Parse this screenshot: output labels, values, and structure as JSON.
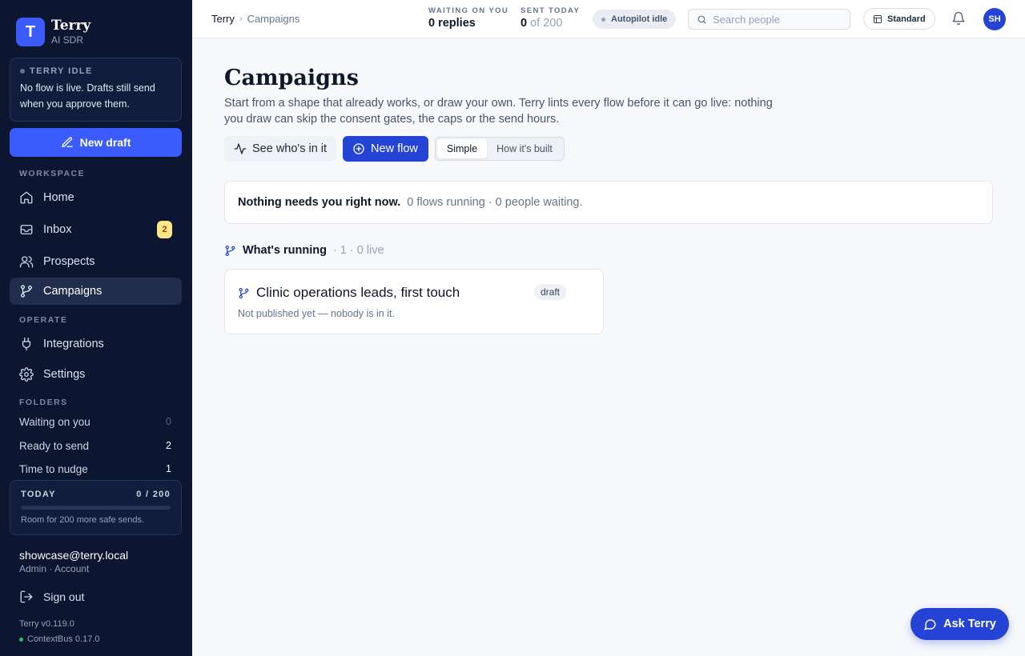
{
  "brand": {
    "logo_letter": "T",
    "name": "Terry",
    "subtitle": "AI SDR"
  },
  "status": {
    "title": "TERRY IDLE",
    "text": "No flow is live. Drafts still send when you approve them."
  },
  "new_draft_label": "New draft",
  "workspace_label": "WORKSPACE",
  "nav": {
    "home": "Home",
    "inbox": "Inbox",
    "inbox_badge": "2",
    "prospects": "Prospects",
    "campaigns": "Campaigns"
  },
  "operate_label": "OPERATE",
  "operate": {
    "integrations": "Integrations",
    "settings": "Settings"
  },
  "folders_label": "FOLDERS",
  "folders": [
    {
      "label": "Waiting on you",
      "count": "0"
    },
    {
      "label": "Ready to send",
      "count": "2"
    },
    {
      "label": "Time to nudge",
      "count": "1"
    }
  ],
  "today": {
    "label": "TODAY",
    "value": "0 / 200",
    "progress_fraction": 0,
    "note": "Room for 200 more safe sends."
  },
  "account": {
    "email": "showcase@terry.local",
    "sub": "Admin · Account"
  },
  "signout_label": "Sign out",
  "version": "Terry v0.119.0",
  "contextbus": "ContextBus 0.17.0",
  "topbar": {
    "crumb_root": "Terry",
    "crumb_current": "Campaigns",
    "waiting_label": "WAITING ON YOU",
    "waiting_value": "0 replies",
    "sent_label": "SENT TODAY",
    "sent_value": "0",
    "sent_of": "of 200",
    "autopilot": "Autopilot idle",
    "search_placeholder": "Search people",
    "mode": "Standard",
    "avatar": "SH"
  },
  "page": {
    "title": "Campaigns",
    "description": "Start from a shape that already works, or draw your own. Terry lints every flow before it can go live: nothing you draw can skip the consent gates, the caps or the send hours.",
    "see_whos_in_it": "See who's in it",
    "new_flow": "New flow",
    "view_simple": "Simple",
    "view_built": "How it's built",
    "notice_strong": "Nothing needs you right now.",
    "notice_rest": "0 flows running · 0 people waiting.",
    "running_title": "What's running",
    "running_meta": "· 1 · 0 live"
  },
  "flow": {
    "title": "Clinic operations leads, first touch",
    "badge": "draft",
    "note": "Not published yet — nobody is in it."
  },
  "ask_terry": "Ask Terry",
  "colors": {
    "sidebar_bg": "#0c1631",
    "accent": "#3b5bfd",
    "primary_button": "#2543d4",
    "badge_bg": "#fde68a"
  }
}
